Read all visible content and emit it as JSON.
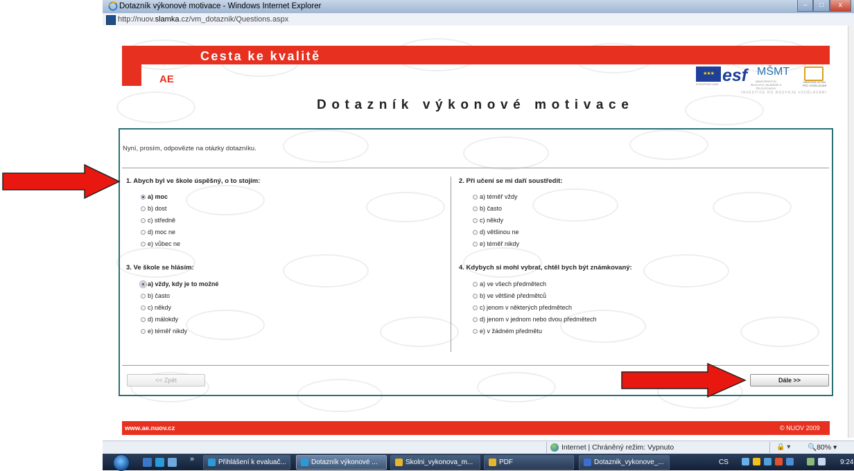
{
  "window": {
    "title": "Dotazník výkonové motivace - Windows Internet Explorer",
    "address_prefix": "http://nuov.",
    "address_domain": "slamka",
    "address_suffix": ".cz/vm_dotaznik/Questions.aspx",
    "controls": {
      "minimize": "–",
      "maximize": "□",
      "close": "x"
    }
  },
  "header": {
    "tagline": "Cesta ke kvalitě",
    "logo_text": "AE",
    "page_title": "Dotazník výkonové motivace",
    "partner_logos": {
      "eu_stars": "★★★",
      "eu_label": "EVROPSKÁ UNIE",
      "esf": "esf",
      "msmt": "MŠMT",
      "msmt_label": "MINISTERSTVO ŠKOLSTVÍ, MLÁDEŽE A TĚLOVÝCHOVY",
      "npi_label": "NÁRODNÍ ÚSTAV PRO VZDĚLÁVÁNÍ",
      "investice": "INVESTICE DO ROZVOJE VZDĚLÁVÁNÍ"
    }
  },
  "form": {
    "intro": "Nyní, prosím, odpovězte na otázky dotazníku.",
    "questions": [
      {
        "title": "1. Abych byl ve škole úspěšný, o to stojím:",
        "options": [
          "a) moc",
          "b) dost",
          "c) středně",
          "d) moc ne",
          "e) vůbec ne"
        ],
        "selected": 0
      },
      {
        "title": "2. Při učení se mi daří soustředit:",
        "options": [
          "a) téměř vždy",
          "b) často",
          "c) někdy",
          "d) většinou ne",
          "e) téměř nikdy"
        ],
        "selected": null
      },
      {
        "title": "3. Ve škole se hlásím:",
        "options": [
          "a) vždy, kdy je to možné",
          "b) často",
          "c) někdy",
          "d) málokdy",
          "e) téměř nikdy"
        ],
        "selected": 0
      },
      {
        "title": "4. Kdybych si mohl vybrat, chtěl bych být známkovaný:",
        "options": [
          "a) ve všech předmětech",
          "b) ve většině předmětců",
          "c) jenom v některých předmětech",
          "d) jenom v jednom nebo dvou předmětech",
          "e) v žádném předmětu"
        ],
        "selected": null
      }
    ],
    "back_label": "<< Zpět",
    "next_label": "Dále >>"
  },
  "footer": {
    "left": "www.ae.nuov.cz",
    "right": "© NUOV 2009"
  },
  "statusbar": {
    "zone": "Internet | Chráněný režim: Vypnuto",
    "security": "🔒 ▾",
    "zoom": "🔍80%  ▾"
  },
  "taskbar": {
    "chevron": "»",
    "items": [
      "Přihlášení k evaluač...",
      "Dotazník výkonové ...",
      "Skolni_vykonova_m...",
      "PDF",
      "Dotaznik_vykonove_..."
    ],
    "lang": "CS",
    "time": "9:24"
  },
  "colors": {
    "brand_red": "#e7301f",
    "frame_teal": "#2a6f72",
    "arrow_red": "#e8170f"
  }
}
